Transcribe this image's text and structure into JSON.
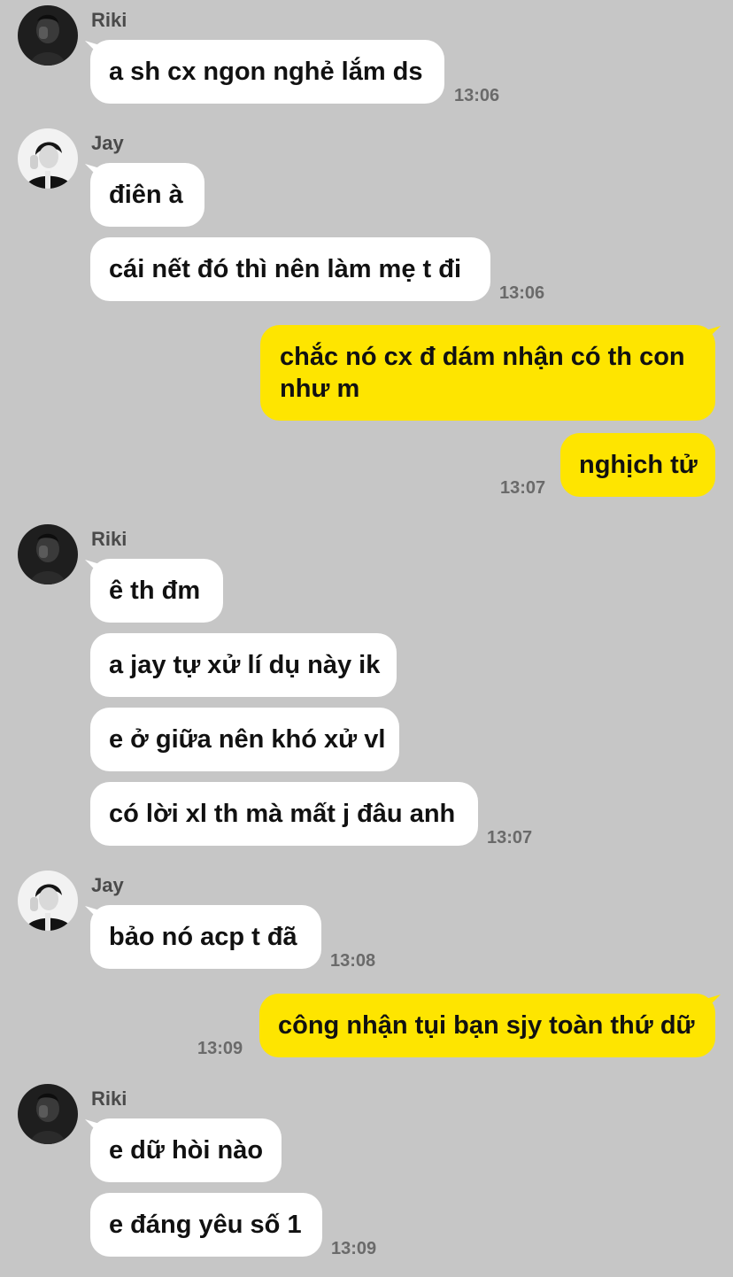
{
  "colors": {
    "background": "#c6c6c6",
    "incoming": "#ffffff",
    "outgoing": "#fee500"
  },
  "participants": {
    "riki": {
      "name": "Riki",
      "avatar": "avatar-dark-portrait"
    },
    "jay": {
      "name": "Jay",
      "avatar": "avatar-bw-portrait"
    }
  },
  "messages": [
    {
      "sender": "Riki",
      "text": "a sh cx ngon nghẻ lắm ds",
      "time": "13:06"
    },
    {
      "sender": "Jay",
      "text": "điên à"
    },
    {
      "sender": "Jay",
      "text": "cái nết đó thì nên làm mẹ t đi",
      "time": "13:06"
    },
    {
      "sender": "me",
      "text": "chắc nó cx đ dám nhận có th con như m"
    },
    {
      "sender": "me",
      "text": "nghịch tử",
      "time": "13:07"
    },
    {
      "sender": "Riki",
      "text": "ê th đm"
    },
    {
      "sender": "Riki",
      "text": "a jay tự xử lí dụ này ik"
    },
    {
      "sender": "Riki",
      "text": "e ở giữa nên khó xử vl"
    },
    {
      "sender": "Riki",
      "text": "có lời xl th mà mất j đâu anh",
      "time": "13:07"
    },
    {
      "sender": "Jay",
      "text": "bảo nó acp t đã",
      "time": "13:08"
    },
    {
      "sender": "me",
      "text": "công nhận tụi bạn sjy toàn thứ dữ",
      "time": "13:09"
    },
    {
      "sender": "Riki",
      "text": "e dữ hòi nào"
    },
    {
      "sender": "Riki",
      "text": "e đáng yêu số 1",
      "time": "13:09"
    }
  ]
}
